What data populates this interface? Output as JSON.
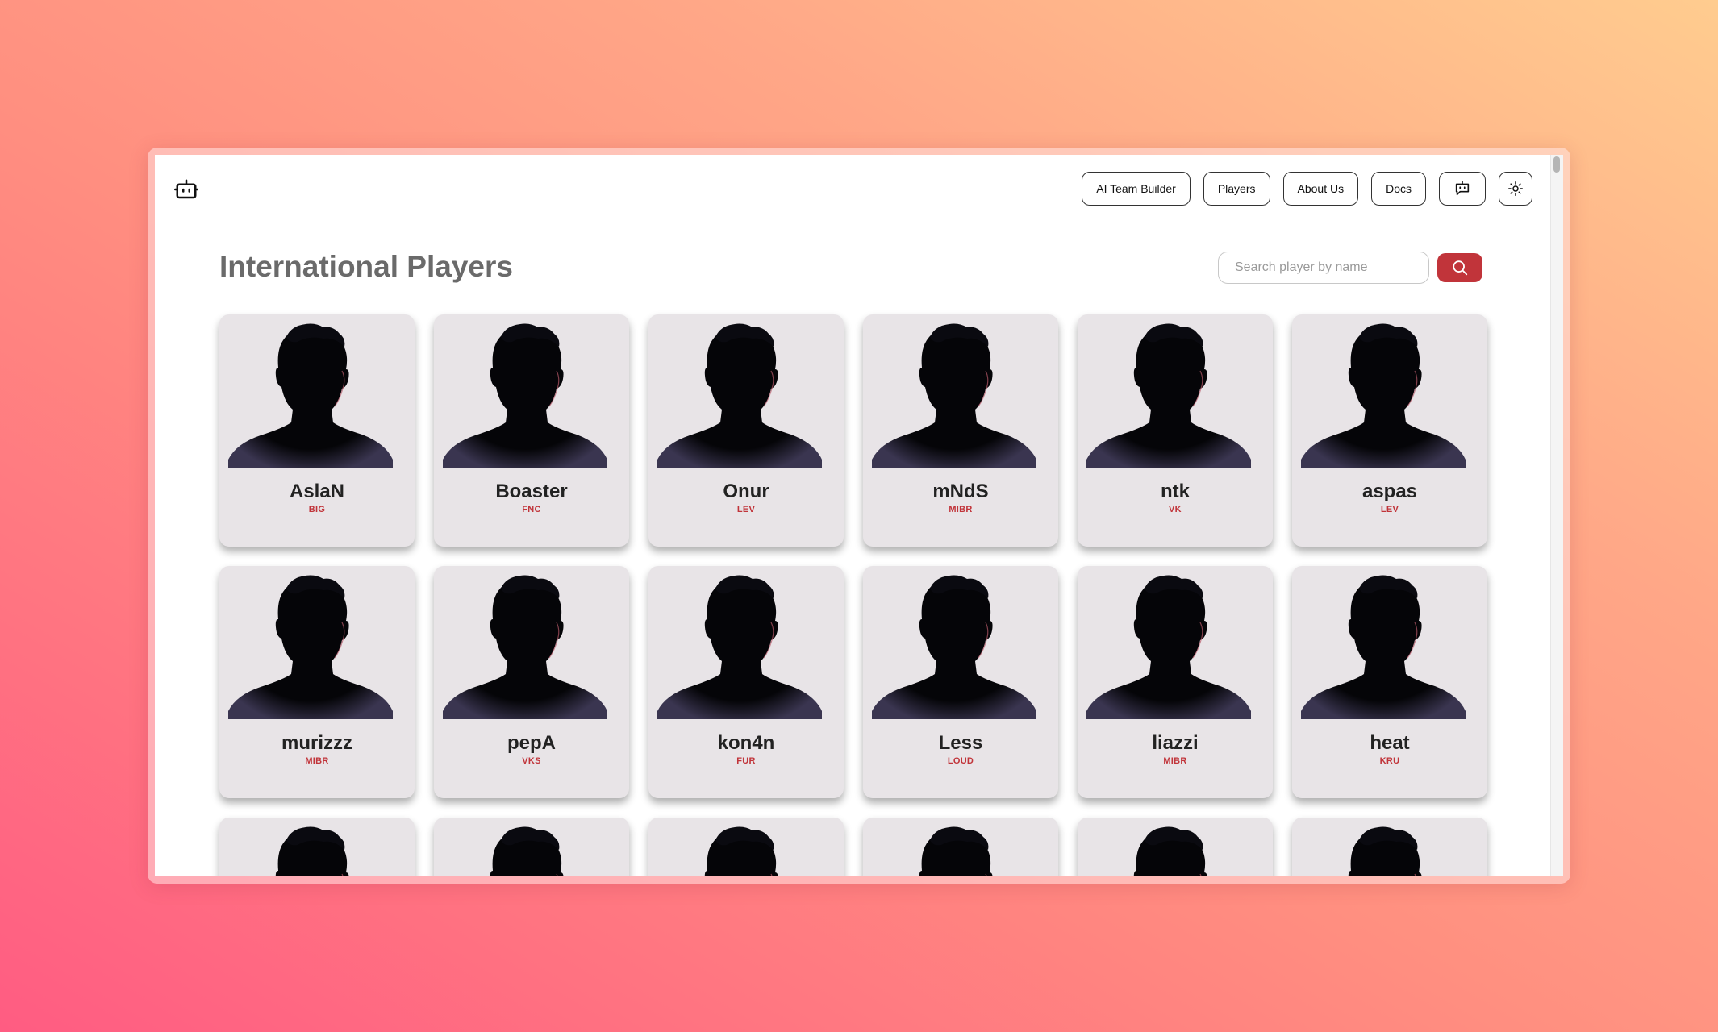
{
  "nav": {
    "logo_icon": "robot-icon",
    "buttons": [
      {
        "label": "AI Team Builder"
      },
      {
        "label": "Players"
      },
      {
        "label": "About Us"
      },
      {
        "label": "Docs"
      }
    ],
    "chat_icon": "chatbot-icon",
    "theme_icon": "sun-icon"
  },
  "page": {
    "title": "International Players"
  },
  "search": {
    "placeholder": "Search player by name",
    "value": "",
    "button_icon": "search-icon",
    "button_color": "#c1343a"
  },
  "players": [
    {
      "name": "AslaN",
      "team": "BIG"
    },
    {
      "name": "Boaster",
      "team": "FNC"
    },
    {
      "name": "Onur",
      "team": "LEV"
    },
    {
      "name": "mNdS",
      "team": "MIBR"
    },
    {
      "name": "ntk",
      "team": "VK"
    },
    {
      "name": "aspas",
      "team": "LEV"
    },
    {
      "name": "murizzz",
      "team": "MIBR"
    },
    {
      "name": "pepA",
      "team": "VKS"
    },
    {
      "name": "kon4n",
      "team": "FUR"
    },
    {
      "name": "Less",
      "team": "LOUD"
    },
    {
      "name": "liazzi",
      "team": "MIBR"
    },
    {
      "name": "heat",
      "team": "KRU"
    },
    {
      "name": "",
      "team": ""
    },
    {
      "name": "",
      "team": ""
    },
    {
      "name": "",
      "team": ""
    },
    {
      "name": "",
      "team": ""
    },
    {
      "name": "",
      "team": ""
    },
    {
      "name": "",
      "team": ""
    }
  ],
  "colors": {
    "accent": "#c1343a",
    "card_bg": "#e8e4e7",
    "title": "#6a6a6a"
  }
}
